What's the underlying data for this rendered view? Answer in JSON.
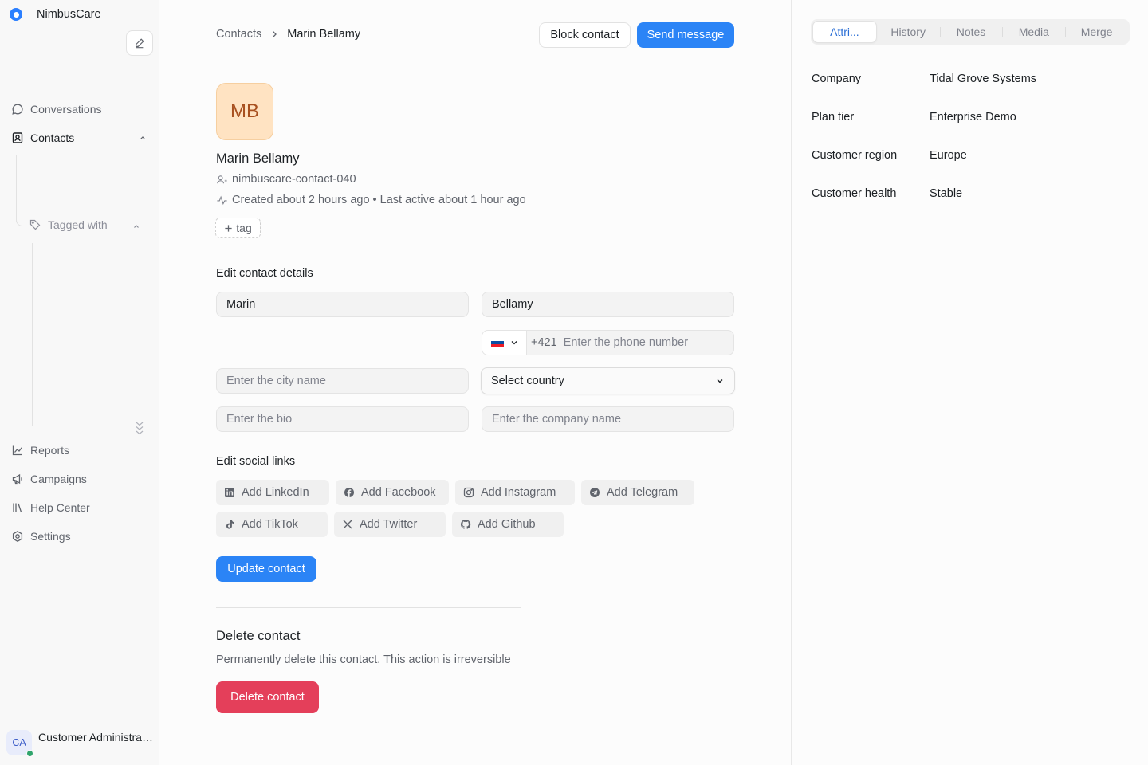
{
  "brand": {
    "name": "NimbusCare"
  },
  "sidebar": {
    "items": [
      {
        "label": "Conversations",
        "icon": "chat-bubble-icon"
      },
      {
        "label": "Contacts",
        "icon": "contact-card-icon"
      },
      {
        "label": "Reports",
        "icon": "line-chart-icon"
      },
      {
        "label": "Campaigns",
        "icon": "megaphone-icon"
      },
      {
        "label": "Help Center",
        "icon": "library-icon"
      },
      {
        "label": "Settings",
        "icon": "gear-icon"
      }
    ],
    "sub_item": {
      "label": "Tagged with",
      "icon": "tag-icon"
    },
    "user": {
      "initials": "CA",
      "name": "Customer Administrator"
    }
  },
  "breadcrumb": {
    "parent": "Contacts",
    "current": "Marin Bellamy"
  },
  "actions": {
    "block": "Block contact",
    "send": "Send message"
  },
  "contact": {
    "initials": "MB",
    "name": "Marin Bellamy",
    "identifier": "nimbuscare-contact-040",
    "activity": "Created about 2 hours ago • Last active about 1 hour ago",
    "tag_button": "tag"
  },
  "edit": {
    "title": "Edit contact details",
    "first_name": "Marin",
    "last_name": "Bellamy",
    "phone_code": "+421",
    "phone_placeholder": "Enter the phone number",
    "city_placeholder": "Enter the city name",
    "country_select": "Select country",
    "bio_placeholder": "Enter the bio",
    "company_placeholder": "Enter the company name"
  },
  "social": {
    "title": "Edit social links",
    "links": [
      {
        "label": "Add LinkedIn",
        "icon": "linkedin-icon"
      },
      {
        "label": "Add Facebook",
        "icon": "facebook-icon"
      },
      {
        "label": "Add Instagram",
        "icon": "instagram-icon"
      },
      {
        "label": "Add Telegram",
        "icon": "telegram-icon"
      },
      {
        "label": "Add TikTok",
        "icon": "tiktok-icon"
      },
      {
        "label": "Add Twitter",
        "icon": "x-twitter-icon"
      },
      {
        "label": "Add Github",
        "icon": "github-icon"
      }
    ],
    "update_button": "Update contact"
  },
  "danger": {
    "title": "Delete contact",
    "description": "Permanently delete this contact. This action is irreversible",
    "button": "Delete contact"
  },
  "panel": {
    "tabs": [
      "Attri...",
      "History",
      "Notes",
      "Media",
      "Merge"
    ],
    "attributes": [
      {
        "key": "Company",
        "value": "Tidal Grove Systems"
      },
      {
        "key": "Plan tier",
        "value": "Enterprise Demo"
      },
      {
        "key": "Customer region",
        "value": "Europe"
      },
      {
        "key": "Customer health",
        "value": "Stable"
      }
    ]
  },
  "colors": {
    "primary": "#2b84f6",
    "danger": "#e43f5a",
    "avatar_bg": "#ffe3c2"
  }
}
